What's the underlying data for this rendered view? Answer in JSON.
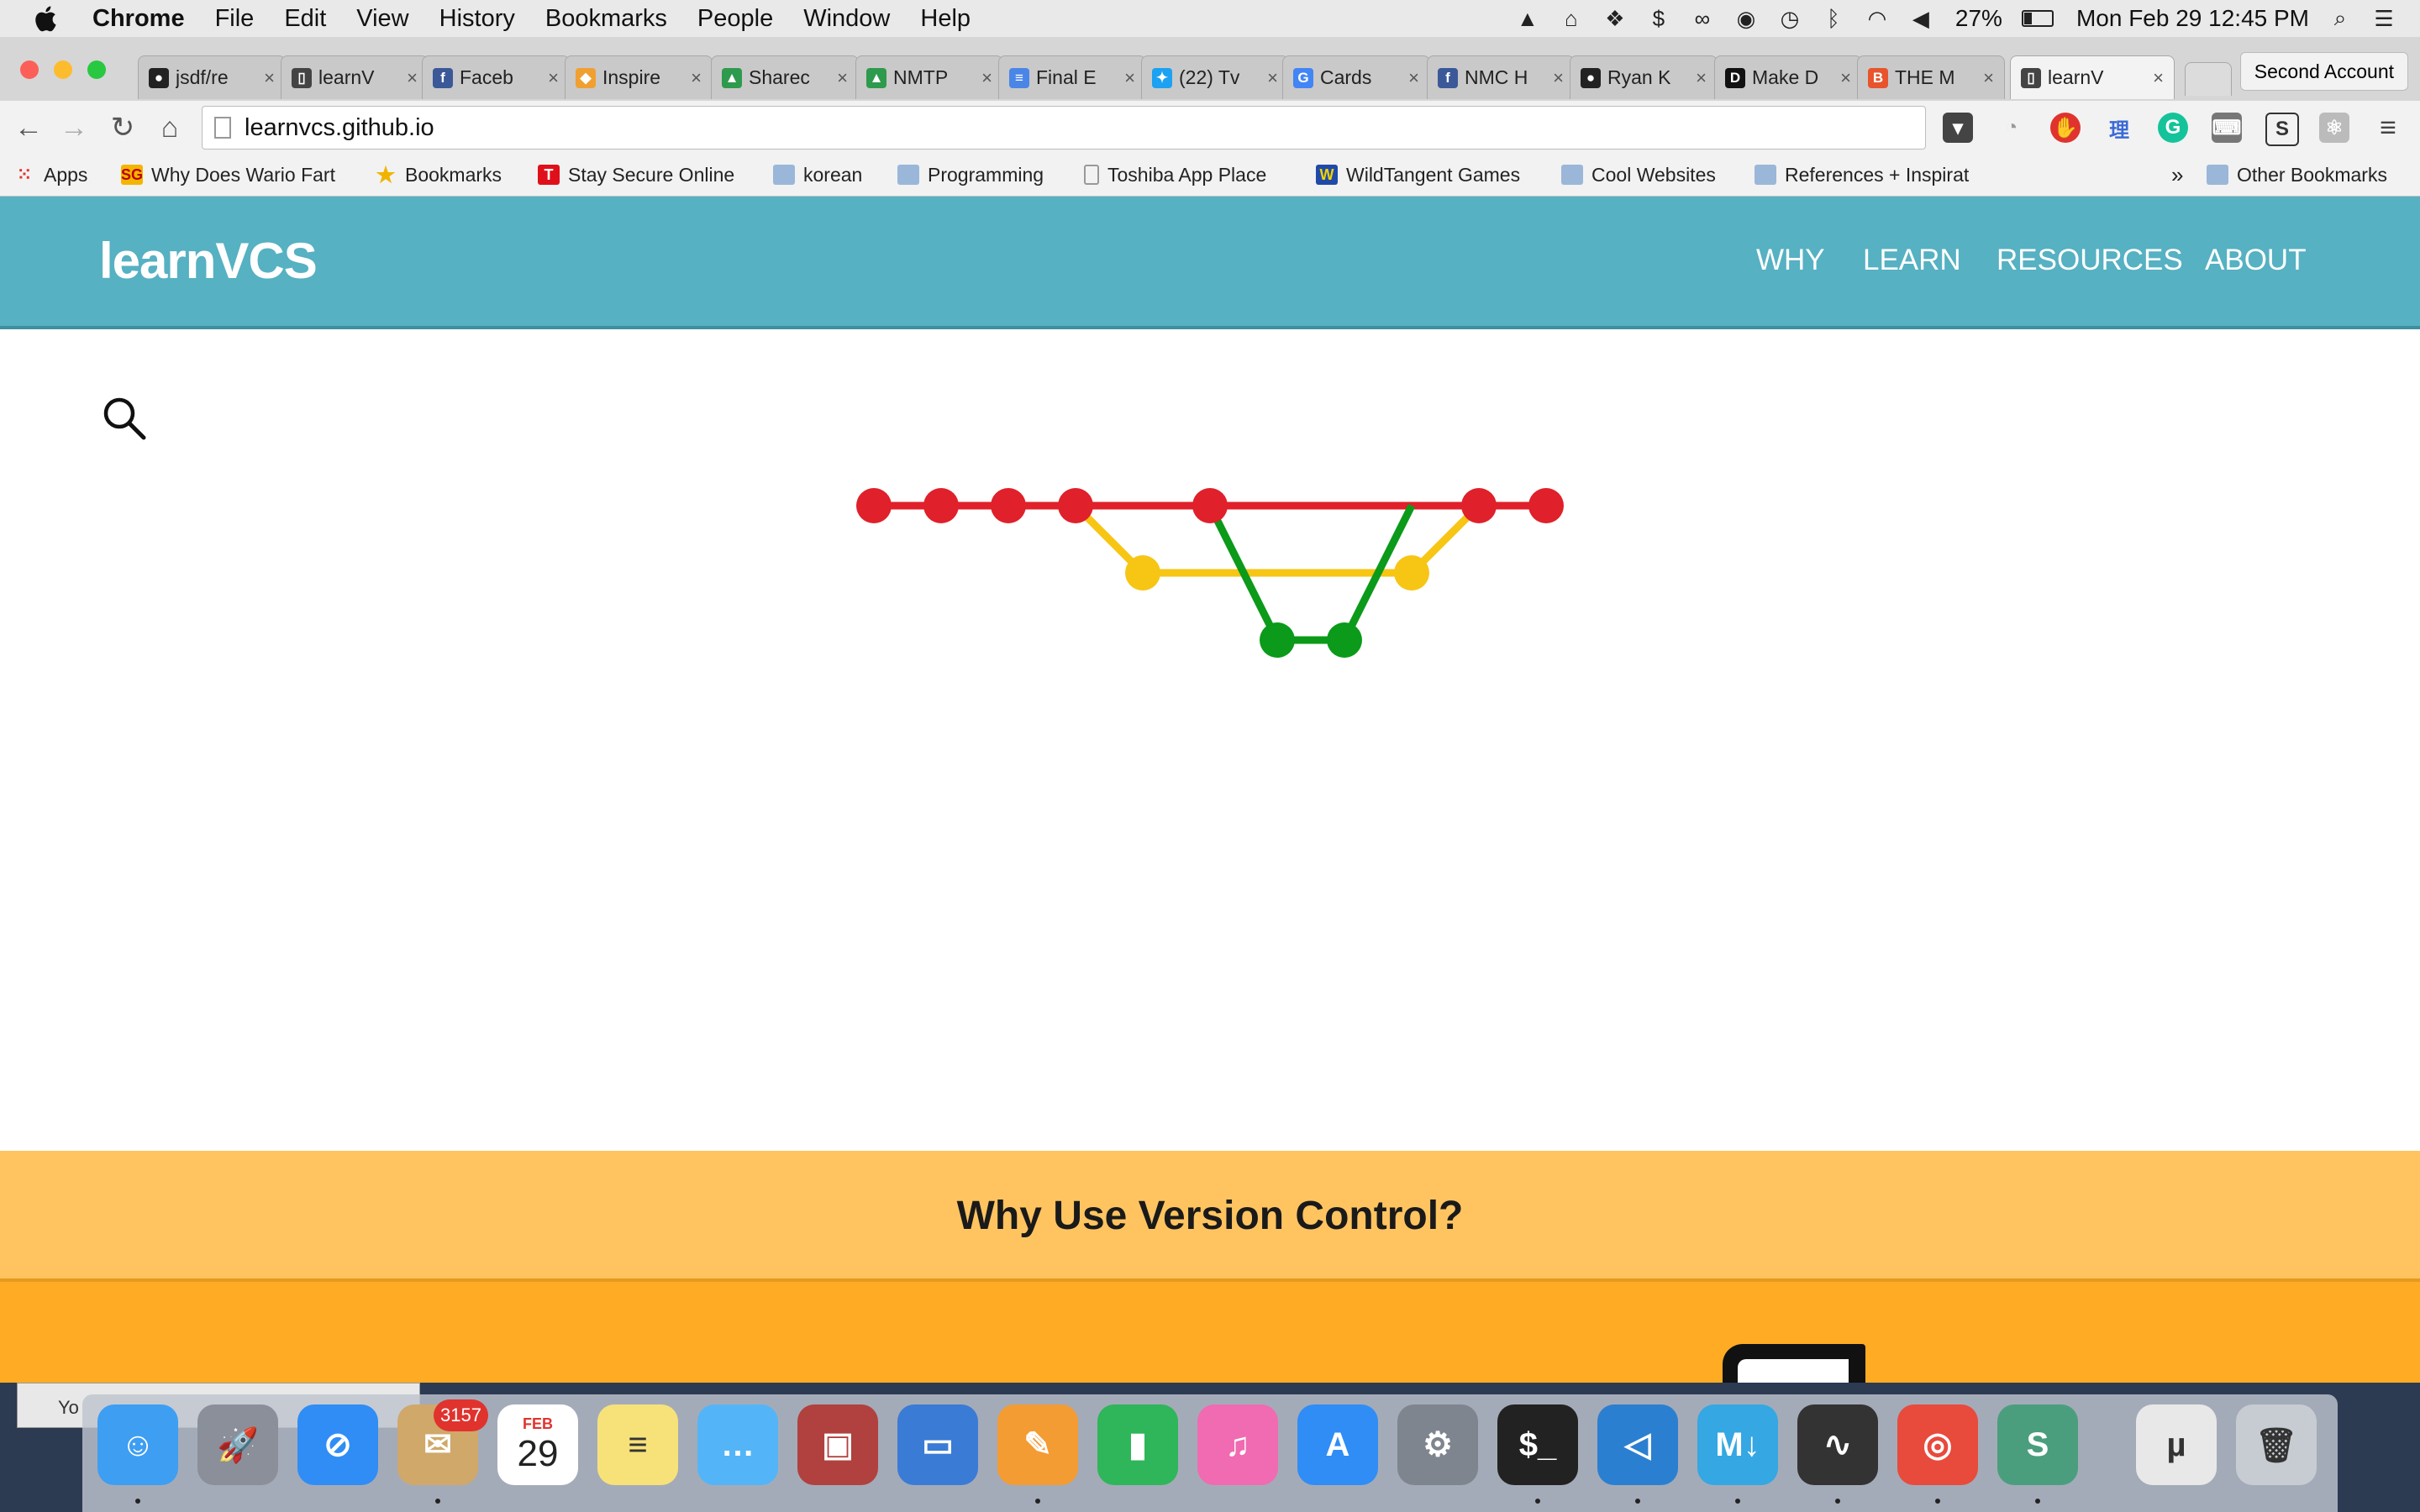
{
  "menubar": {
    "app": "Chrome",
    "items": [
      "File",
      "Edit",
      "View",
      "History",
      "Bookmarks",
      "People",
      "Window",
      "Help"
    ],
    "battery": "27%",
    "clock": "Mon Feb 29  12:45 PM"
  },
  "tabs": [
    {
      "label": "jsdf/re",
      "icon": "github-icon",
      "color": "#222222"
    },
    {
      "label": "learnV",
      "icon": "book-icon",
      "color": "#444444"
    },
    {
      "label": "Faceb",
      "icon": "facebook-icon",
      "color": "#3b5998"
    },
    {
      "label": "Inspire",
      "icon": "sketch-icon",
      "color": "#f0a030"
    },
    {
      "label": "Sharec",
      "icon": "drive-icon",
      "color": "#2e9a4d"
    },
    {
      "label": "NMTP",
      "icon": "drive-icon",
      "color": "#2e9a4d"
    },
    {
      "label": "Final E",
      "icon": "docs-icon",
      "color": "#4a86e8"
    },
    {
      "label": "(22) Tv",
      "icon": "twitter-icon",
      "color": "#1da1f2"
    },
    {
      "label": "Cards",
      "icon": "google-icon",
      "color": "#4285f4"
    },
    {
      "label": "NMC H",
      "icon": "facebook-icon",
      "color": "#3b5998"
    },
    {
      "label": "Ryan K",
      "icon": "medium-icon",
      "color": "#222222"
    },
    {
      "label": "Make D",
      "icon": "d-icon",
      "color": "#111111"
    },
    {
      "label": "THE M",
      "icon": "bmo-icon",
      "color": "#e8542c"
    },
    {
      "label": "learnV",
      "icon": "book-icon",
      "color": "#444444",
      "active": true
    }
  ],
  "profile": "Second Account",
  "omnibox": {
    "url": "learnvcs.github.io"
  },
  "bookmarks": [
    {
      "label": "Apps",
      "icon": "apps-grid-icon"
    },
    {
      "label": "Why Does Wario Fart",
      "icon": "sg-icon"
    },
    {
      "label": "Bookmarks",
      "icon": "star-icon"
    },
    {
      "label": "Stay Secure Online",
      "icon": "t-icon"
    },
    {
      "label": "korean",
      "icon": "folder-icon"
    },
    {
      "label": "Programming",
      "icon": "folder-icon"
    },
    {
      "label": "Toshiba App Place",
      "icon": "page-icon"
    },
    {
      "label": "WildTangent Games",
      "icon": "w-icon"
    },
    {
      "label": "Cool Websites",
      "icon": "folder-icon"
    },
    {
      "label": "References + Inspirat",
      "icon": "folder-icon"
    },
    {
      "label": "Other Bookmarks",
      "icon": "folder-icon"
    }
  ],
  "site": {
    "logo": "learnVCS",
    "nav": [
      "WHY",
      "LEARN",
      "RESOURCES",
      "ABOUT"
    ],
    "section_heading": "Why Use Version Control?",
    "graph_colors": {
      "master": "#e0202a",
      "feature": "#f7c514",
      "topic": "#0b9a1a"
    }
  },
  "dock": {
    "mail_badge": "3157",
    "calendar_month": "FEB",
    "calendar_day": "29",
    "behind_window_text": "Yo"
  }
}
